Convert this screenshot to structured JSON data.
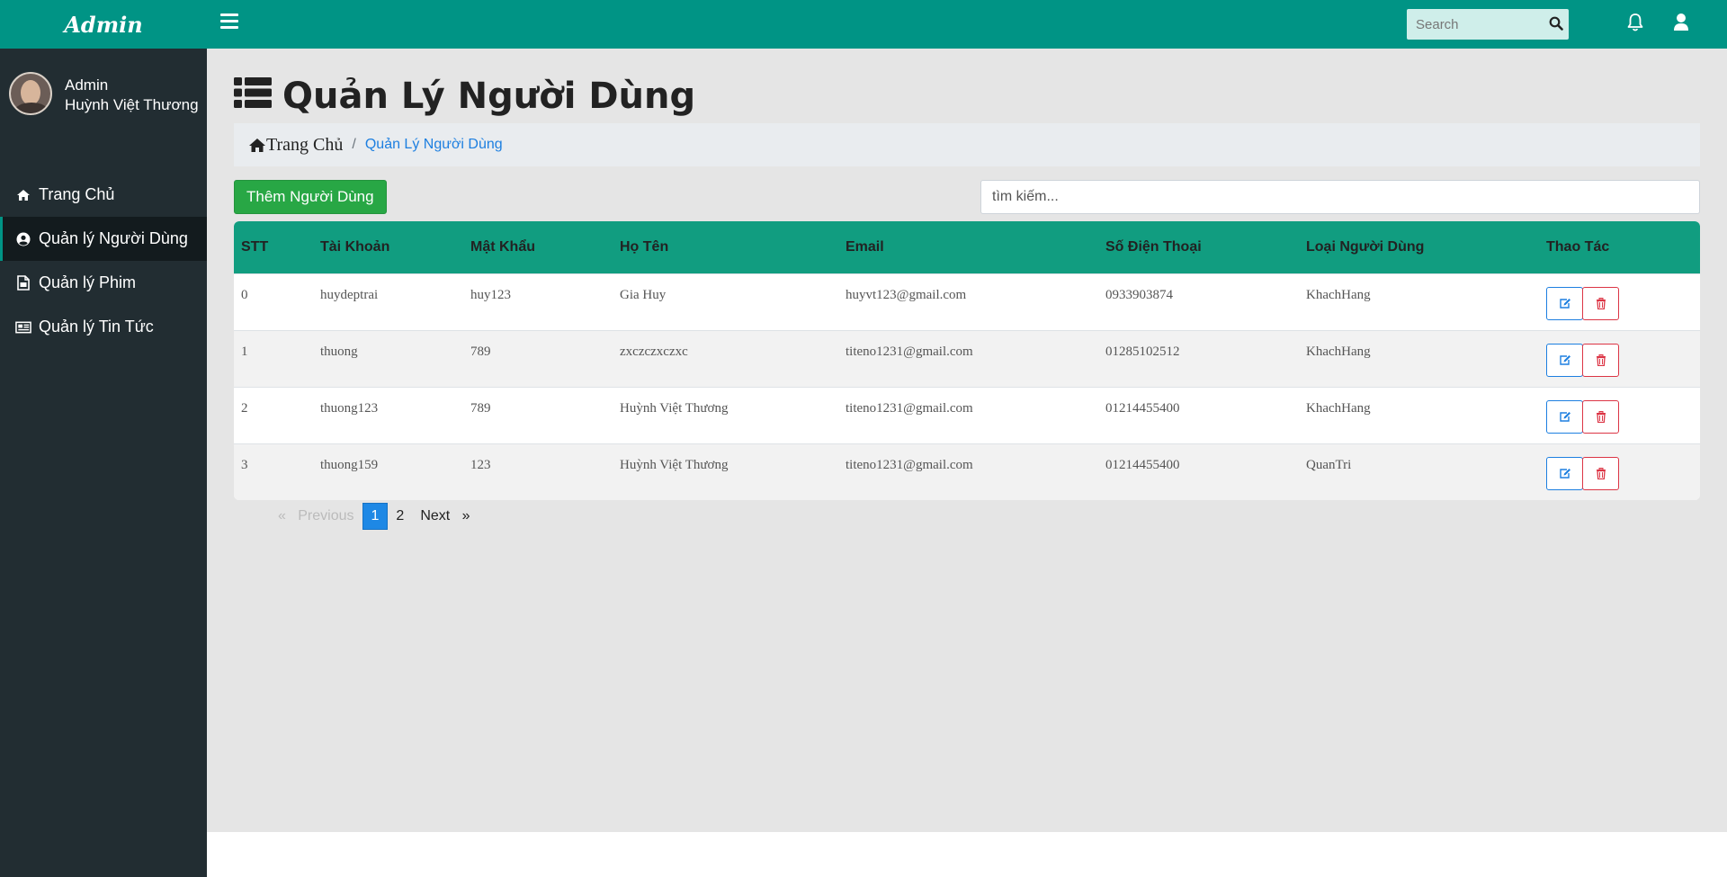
{
  "brand": {
    "title": "Admin"
  },
  "user": {
    "role": "Admin",
    "name": "Huỳnh Việt Thương"
  },
  "sidebar": {
    "items": [
      {
        "label": "Trang Chủ",
        "icon": "home-icon"
      },
      {
        "label": "Quản lý Người Dùng",
        "icon": "user-circle-icon",
        "active": true
      },
      {
        "label": "Quản lý Phim",
        "icon": "file-image-icon"
      },
      {
        "label": "Quản lý Tin Tức",
        "icon": "newspaper-icon"
      }
    ]
  },
  "topbar": {
    "search_placeholder": "Search"
  },
  "page": {
    "title": "Quản Lý Người Dùng",
    "breadcrumb": {
      "home": "Trang Chủ",
      "separator": "/",
      "current": "Quản Lý Người Dùng"
    },
    "add_button": "Thêm Người Dùng",
    "search_placeholder": "tìm kiếm..."
  },
  "table": {
    "headers": [
      "STT",
      "Tài Khoản",
      "Mật Khẩu",
      "Họ Tên",
      "Email",
      "Số Điện Thoại",
      "Loại Người Dùng",
      "Thao Tác"
    ],
    "rows": [
      [
        "0",
        "huydeptrai",
        "huy123",
        "Gia Huy",
        "huyvt123@gmail.com",
        "0933903874",
        "KhachHang"
      ],
      [
        "1",
        "thuong",
        "789",
        "zxczczxczxc",
        "titeno1231@gmail.com",
        "01285102512",
        "KhachHang"
      ],
      [
        "2",
        "thuong123",
        "789",
        "Huỳnh Việt Thương",
        "titeno1231@gmail.com",
        "01214455400",
        "KhachHang"
      ],
      [
        "3",
        "thuong159",
        "123",
        "Huỳnh Việt Thương",
        "titeno1231@gmail.com",
        "01214455400",
        "QuanTri"
      ]
    ]
  },
  "pagination": {
    "prev_arrow": "«",
    "prev": "Previous",
    "pages": [
      "1",
      "2"
    ],
    "current": "1",
    "next": "Next",
    "next_arrow": "»"
  },
  "colors": {
    "primary": "#009485",
    "sidebar": "#222d32",
    "table_header": "#119d80",
    "add_button": "#28a745",
    "edit": "#1d7fe0",
    "delete": "#dc3545",
    "page_active": "#1e88e5"
  }
}
